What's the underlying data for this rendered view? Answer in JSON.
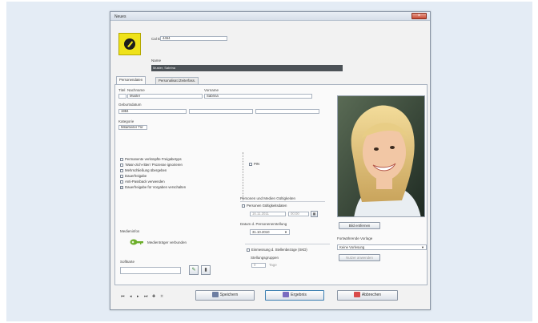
{
  "window": {
    "title": "Neues",
    "close_icon": "×"
  },
  "header": {
    "id_label": "Cal ID",
    "id_value": "4464",
    "name_label": "Name",
    "name_value": "Muster, Sabrina",
    "accent_color": "#efe21a"
  },
  "tabs": [
    {
      "label": "Personendaten",
      "active": true
    },
    {
      "label": "Personalisat./Zeiterfass.",
      "active": false
    }
  ],
  "person": {
    "title_label": "Titel",
    "surname_label": "Nachname",
    "firstname_label": "Vorname",
    "title_value": "",
    "surname_value": "Muster",
    "firstname_value": "Sabrina",
    "birthdate_label": "Geburtsdatum",
    "birthdate_value": "1984",
    "extra1_value": "",
    "extra2_value": "",
    "category_label": "Kategorie",
    "category_value": "Mitarbeiter Tür"
  },
  "checkboxes": [
    {
      "label": "Permanente verknüpfte Freigabetyps",
      "checked": false
    },
    {
      "label": "'Wasn-zich-ritten' Prozesse ignorieren",
      "checked": false
    },
    {
      "label": "Mehrschließung übergeben",
      "checked": false
    },
    {
      "label": "Dauerfreigabe",
      "checked": false
    },
    {
      "label": "Anti-Passback verwenden",
      "checked": false
    },
    {
      "label": "Dauerfreigabe für Vorgaben verschalten",
      "checked": true
    }
  ],
  "pin": {
    "label": "PIN",
    "checked": false
  },
  "validity": {
    "section_label": "Personen und Medien Gültigkeiten",
    "cb_label": "Personen Gültigkeitsdaten",
    "date_from": "16.11.2011",
    "time_from": "00:00",
    "group_label": "Datum d. Personenerstellung",
    "date_value": "31.10.2010"
  },
  "media": {
    "label": "Medieninfos",
    "status": "Medienträger verbunden",
    "card_label": "Softkarte",
    "card_value": ""
  },
  "registration": {
    "cb_label": "Einmessung d. Stellenbezüge (SKD)",
    "sub_label": "Stellungsgruppen",
    "value": "0",
    "unit": "Tage"
  },
  "photo": {
    "delete_btn": "Bild entfernen",
    "profile_label": "Fortwährende Vorlage",
    "profile_value": "Keine Vorlesung",
    "apply_btn": "Nutzer anwenden"
  },
  "footer": {
    "nav_icons": [
      "first-icon",
      "prev-icon",
      "next-icon",
      "last-icon",
      "add-icon",
      "delete-icon"
    ],
    "save": "Speichern",
    "continue": "Ergebnis",
    "cancel": "Abbrechen"
  }
}
